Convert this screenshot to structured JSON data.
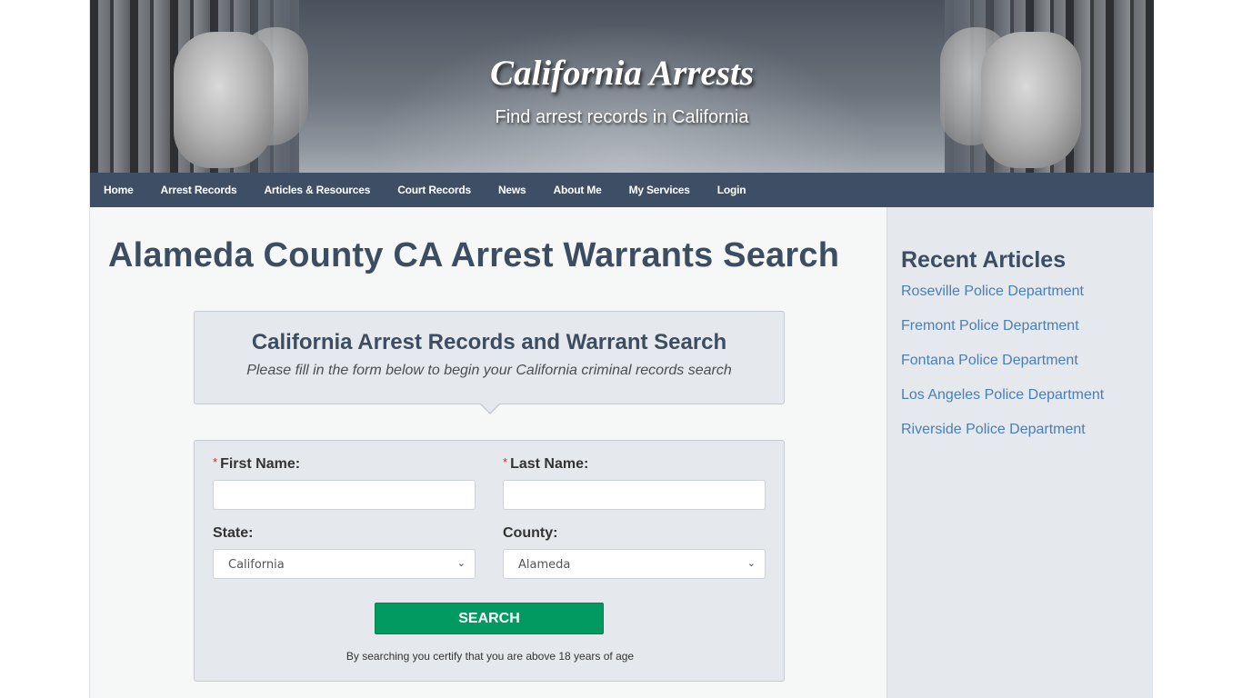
{
  "header": {
    "site_title": "California Arrests",
    "tagline": "Find arrest records in California"
  },
  "nav": {
    "items": [
      {
        "label": "Home"
      },
      {
        "label": "Arrest Records"
      },
      {
        "label": "Articles & Resources"
      },
      {
        "label": "Court Records"
      },
      {
        "label": "News"
      },
      {
        "label": "About Me"
      },
      {
        "label": "My Services"
      },
      {
        "label": "Login"
      }
    ]
  },
  "main": {
    "page_title": "Alameda County CA Arrest Warrants Search",
    "callout": {
      "heading": "California Arrest Records and Warrant Search",
      "subheading": "Please fill in the form below to begin your California criminal records search"
    },
    "form": {
      "required_marker": "*",
      "first_name_label": "First Name:",
      "first_name_value": "",
      "last_name_label": "Last Name:",
      "last_name_value": "",
      "state_label": "State:",
      "state_selected": "California",
      "county_label": "County:",
      "county_selected": "Alameda",
      "search_button": "SEARCH",
      "disclaimer": "By searching you certify that you are above 18 years of age"
    }
  },
  "sidebar": {
    "heading": "Recent Articles",
    "articles": [
      {
        "label": "Roseville Police Department"
      },
      {
        "label": "Fremont Police Department"
      },
      {
        "label": "Fontana Police Department"
      },
      {
        "label": "Los Angeles Police Department"
      },
      {
        "label": "Riverside Police Department"
      }
    ]
  },
  "colors": {
    "nav_bg": "#2e4058",
    "heading": "#3c4d62",
    "link": "#4a7fb5",
    "search_button": "#039a62",
    "required": "#d9232d"
  }
}
